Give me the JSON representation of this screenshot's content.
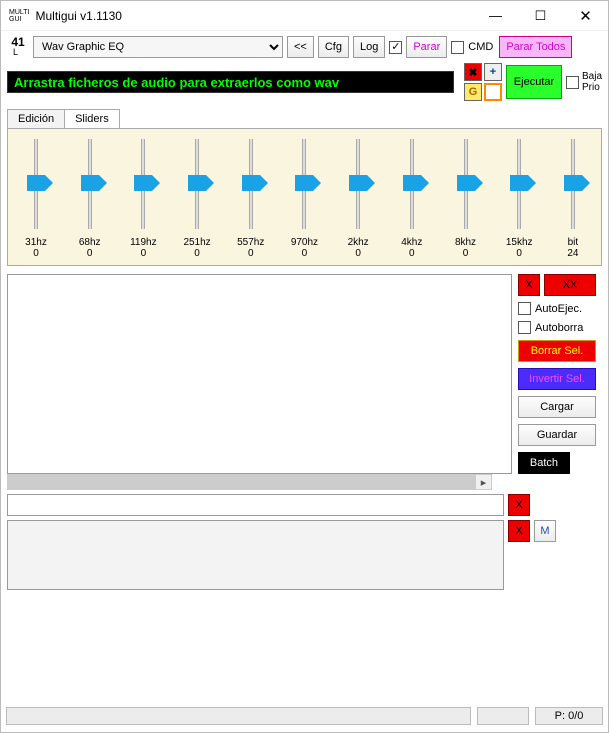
{
  "window": {
    "title": "Multigui v1.1130",
    "logo1": "MULTI",
    "logo2": "GUI"
  },
  "toolbar": {
    "index": "41",
    "indexSub": "L",
    "combo": "Wav Graphic EQ",
    "back": "<<",
    "cfg": "Cfg",
    "log": "Log",
    "log_checked": true,
    "parar": "Parar",
    "cmd_checked": false,
    "cmd": "CMD",
    "parar_todos": "Parar Todos"
  },
  "row2": {
    "banner": "Arrastra ficheros de audio para extraerlos como wav",
    "ejecutar": "Ejecutar",
    "baja1": "Baja",
    "baja2": "Prio",
    "baja_checked": false
  },
  "tabs": {
    "edicion": "Edición",
    "sliders": "Sliders"
  },
  "sliders": [
    {
      "lab": "31hz",
      "val": "0"
    },
    {
      "lab": "68hz",
      "val": "0"
    },
    {
      "lab": "119hz",
      "val": "0"
    },
    {
      "lab": "251hz",
      "val": "0"
    },
    {
      "lab": "557hz",
      "val": "0"
    },
    {
      "lab": "970hz",
      "val": "0"
    },
    {
      "lab": "2khz",
      "val": "0"
    },
    {
      "lab": "4khz",
      "val": "0"
    },
    {
      "lab": "8khz",
      "val": "0"
    },
    {
      "lab": "15khz",
      "val": "0"
    },
    {
      "lab": "bit",
      "val": "24"
    }
  ],
  "side": {
    "x": "X",
    "xx": "XX",
    "autoejec": "AutoEjec.",
    "autoejec_checked": false,
    "autoborra": "Autoborra",
    "autoborra_checked": false,
    "borrar": "Borrar Sel.",
    "invertir": "Invertir Sel.",
    "cargar": "Cargar",
    "guardar": "Guardar",
    "batch": "Batch"
  },
  "bottom": {
    "x": "X",
    "m": "M"
  },
  "status": {
    "p": "P: 0/0"
  }
}
